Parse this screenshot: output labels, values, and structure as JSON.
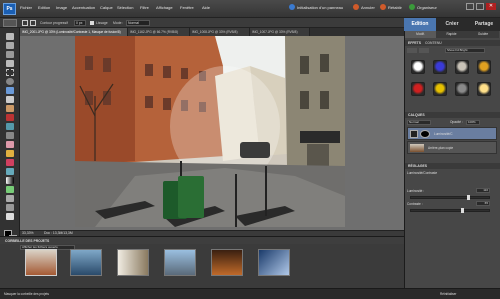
{
  "menu": {
    "logo": "Ps",
    "items": [
      "Fichier",
      "Edition",
      "Image",
      "Accentuation",
      "Calque",
      "Sélection",
      "Filtre",
      "Affichage",
      "Fenêtre",
      "Aide"
    ],
    "right": [
      "Initialisation d'un panneau",
      "Annuler",
      "Rétablir",
      "Organiseur"
    ]
  },
  "mode_tabs": [
    "Edition",
    "Créer",
    "Partage"
  ],
  "options_bar": {
    "contour_label": "Contour progressif",
    "contour_value": "0 px",
    "lissage": "Lissage",
    "mode_label": "Mode :",
    "mode_value": "Normal"
  },
  "doc_tabs": [
    "IMG_2001.JPG @ 33% (Luminosité/Contraste 1, Masque de fusion/8)",
    "IMG_1162.JPG @ 66.7% (RVB/8)",
    "IMG_1008.JPG @ 33% (RVB/8)",
    "IMG_1007.JPG @ 33% (RVB/8)"
  ],
  "status": {
    "zoom": "33,33%",
    "doc": "Doc : 13,3M/13,3M"
  },
  "bin": {
    "header": "CORBEILLE DES PROJETS",
    "dropdown": "Afficher les fichiers ouverts"
  },
  "panel": {
    "subtabs": [
      "Modif.",
      "Rapide",
      "Guidée"
    ],
    "effects_header": "EFFETS",
    "effects_tabs": [
      "EFFETS",
      "CONTENU"
    ],
    "effects_dropdown": "Show Fd Bright",
    "swatch_colors": [
      "#ffffff",
      "#3a3ad8",
      "#c9c3b8",
      "#e0a020",
      "#d02020",
      "#e6c000",
      "#8a8a8a",
      "#ffe08a"
    ],
    "layers_header": "CALQUES",
    "blend_mode": "Normal",
    "opacity_label": "Opacité :",
    "opacity_value": "100%",
    "layer_adjust": "Luminosité/C",
    "layer_bg": "Arrière-plan copie",
    "adjust_header": "RÉGLAGES",
    "adjust_title": "Luminosité/Contraste",
    "brightness_label": "Luminosité :",
    "brightness_value": "110",
    "contrast_label": "Contraste :",
    "contrast_value": "65",
    "brightness_fraction": 0.74,
    "contrast_fraction": 0.66
  },
  "bottom": {
    "left_label": "Masquer la corbeille des projets",
    "right_label": "Réinitialiser"
  }
}
